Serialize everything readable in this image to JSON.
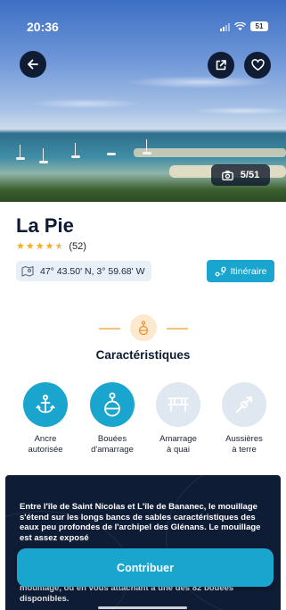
{
  "status_bar": {
    "time": "20:36",
    "battery": "51"
  },
  "hero": {
    "photo_counter": "5/51"
  },
  "spot": {
    "name": "La Pie",
    "rating": 4.5,
    "review_count": "(52)",
    "coordinates": "47° 43.50' N, 3° 59.68' W",
    "itinerary_label": "Itinéraire"
  },
  "characteristics": {
    "title": "Caractéristiques",
    "items": [
      {
        "label": "Ancre\nautorisée",
        "icon": "anchor-icon",
        "active": true
      },
      {
        "label": "Bouées\nd'amarrage",
        "icon": "mooring-buoy-icon",
        "active": true
      },
      {
        "label": "Amarrage\nà quai",
        "icon": "quay-icon",
        "active": false
      },
      {
        "label": "Aussières\nà terre",
        "icon": "shore-line-icon",
        "active": false
      }
    ]
  },
  "description": {
    "text": "Entre l'île de Saint Nicolas et L'île de Bananec, le mouillage s'étend sur les longs bancs de sables caractéristiques des eaux peu profondes de l'archipel des Glénans. Le mouillage est assez exposé",
    "tail": "mouillage, ou en vous attachant à une des 82 bouées disponibles."
  },
  "cta": {
    "label": "Contribuer"
  },
  "colors": {
    "accent": "#1aa5cf",
    "navy": "#0f1c35",
    "star": "#f2b01e",
    "buoy_badge": "#fde9cf"
  }
}
